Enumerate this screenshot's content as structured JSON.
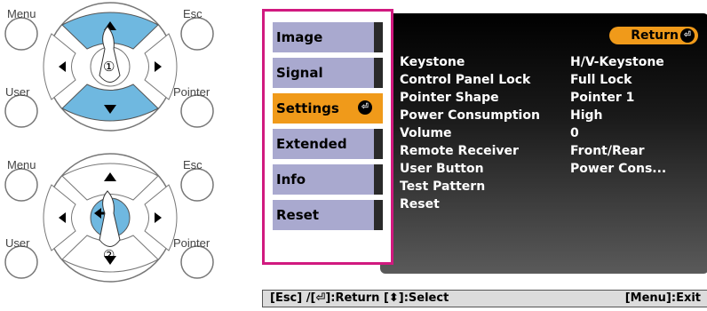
{
  "remotes": {
    "top": {
      "menu_label": "Menu",
      "esc_label": "Esc",
      "user_label": "User",
      "pointer_label": "Pointer",
      "step_label": "①"
    },
    "bottom": {
      "menu_label": "Menu",
      "esc_label": "Esc",
      "user_label": "User",
      "pointer_label": "Pointer",
      "step_label": "②"
    }
  },
  "menu": {
    "tabs": [
      "Image",
      "Signal",
      "Settings",
      "Extended",
      "Info",
      "Reset"
    ],
    "active_tab": "Settings",
    "return_label": "Return",
    "rows": [
      {
        "label": "Keystone",
        "value": "H/V-Keystone"
      },
      {
        "label": "Control Panel Lock",
        "value": "Full Lock"
      },
      {
        "label": "Pointer Shape",
        "value": "Pointer 1"
      },
      {
        "label": "Power Consumption",
        "value": "High"
      },
      {
        "label": "Volume",
        "value": "0"
      },
      {
        "label": "Remote Receiver",
        "value": "Front/Rear"
      },
      {
        "label": "User Button",
        "value": "Power Cons..."
      },
      {
        "label": "Test Pattern",
        "value": ""
      },
      {
        "label": "Reset",
        "value": ""
      }
    ]
  },
  "status_bar": {
    "left": "[Esc] /[⏎]:Return [⬍]:Select",
    "right": "[Menu]:Exit"
  },
  "colors": {
    "highlight": "#f09a1a",
    "tab": "#a9a9cf",
    "frame": "#d1197f",
    "remote_button": "#6fb8e0"
  }
}
